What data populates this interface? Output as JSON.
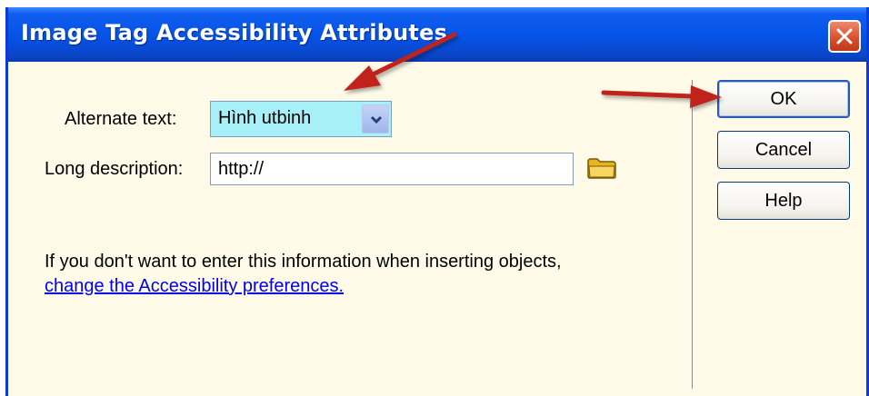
{
  "window": {
    "title": "Image Tag Accessibility Attributes"
  },
  "titlebar": {
    "close_icon": "close-x-icon"
  },
  "form": {
    "alt_label": "Alternate text:",
    "alt_value": "Hình utbinh",
    "long_label": "Long description:",
    "long_value": "http://",
    "browse_icon": "folder-icon"
  },
  "info": {
    "text": "If you don't want to enter this information when inserting objects,",
    "link": "change the Accessibility preferences."
  },
  "buttons": {
    "ok": "OK",
    "cancel": "Cancel",
    "help": "Help"
  },
  "annotations": {
    "arrow_color": "#c0201e"
  },
  "colors": {
    "title_bar": "#0553e6",
    "dialog_bg": "#fffbe8",
    "alt_field_bg": "#a8f0f8",
    "link": "#0000ee"
  }
}
